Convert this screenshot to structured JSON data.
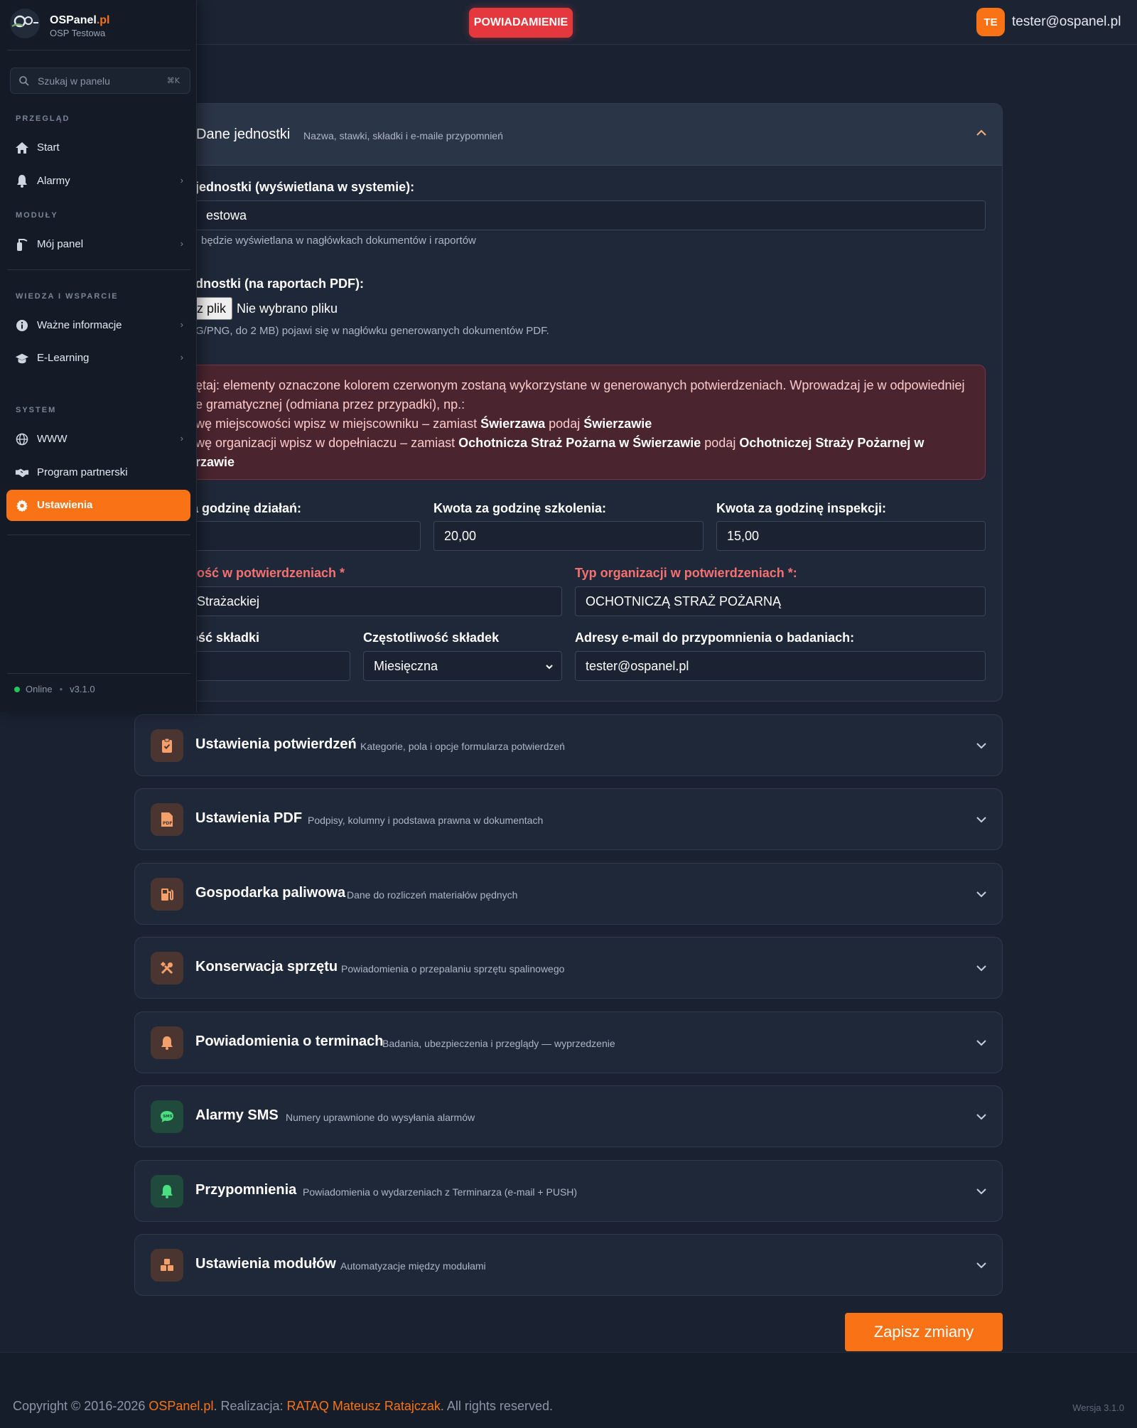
{
  "colors": {
    "accent": "#f97316",
    "alert": "#e5383e",
    "background": "#1a2232",
    "sidebar": "#141b27",
    "online": "#22c55e",
    "required_label": "#f87171"
  },
  "header": {
    "alert_button": "POWIADAMIENIE",
    "avatar_initials": "TE",
    "user_email": "tester@ospanel.pl"
  },
  "sidebar": {
    "brand_name": "OSPanel",
    "brand_tld": ".pl",
    "brand_sub": "OSP Testowa",
    "search_placeholder": "Szukaj w panelu",
    "search_shortcut": "⌘K",
    "sections": {
      "overview": "PRZEGLĄD",
      "modules": "MODUŁY",
      "knowledge": "WIEDZA I WSPARCIE",
      "system": "SYSTEM"
    },
    "items": [
      {
        "label": "Start",
        "icon": "home-icon"
      },
      {
        "label": "Alarmy",
        "icon": "bell-icon"
      },
      {
        "label": "Mój panel",
        "icon": "fire-extinguisher-icon"
      },
      {
        "label": "Ważne informacje",
        "icon": "info-icon"
      },
      {
        "label": "E-Learning",
        "icon": "graduation-cap-icon"
      },
      {
        "label": "WWW",
        "icon": "globe-icon"
      },
      {
        "label": "Program partnerski",
        "icon": "handshake-icon"
      },
      {
        "label": "Ustawienia",
        "icon": "gear-icon"
      }
    ],
    "status": "Online",
    "version": "v3.1.0"
  },
  "unit_panel": {
    "title": "Dane jednostki",
    "subtitle": "Nazwa, stawki, składki i e-maile przypomnień",
    "name_label": "jednostki (wyświetlana w systemie):",
    "name_value": "estowa",
    "name_help": "będzie wyświetlana w nagłówkach dokumentów i raportów",
    "logo_label": "dnostki (na raportach PDF):",
    "file_button": "z plik",
    "file_status": "Nie wybrano pliku",
    "logo_help": "G/PNG, do 2 MB) pojawi się w nagłówku generowanych dokumentów PDF.",
    "note": {
      "line1": "ętaj: elementy oznaczone kolorem czerwonym zostaną wykorzystane w generowanych potwierdzeniach. Wprowadzaj je w odpowiedniej",
      "line2": "e gramatycznej (odmiana przez przypadki), np.:",
      "line3_a": "wę miejscowości wpisz w miejscowniku – zamiast ",
      "line3_b": "Świerzawa",
      "line3_c": " podaj ",
      "line3_d": "Świerzawie",
      "line4_a": "wę organizacji wpisz w dopełniaczu – zamiast ",
      "line4_b": "Ochotnicza Straż Pożarna w Świerzawie",
      "line4_c": " podaj ",
      "line4_d": "Ochotniczej Straży Pożarnej w",
      "line5": "rzawie"
    },
    "rate_action_label": "za godzinę działań:",
    "rate_action_value": "",
    "rate_training_label": "Kwota za godzinę szkolenia:",
    "rate_training_value": "20,00",
    "rate_inspection_label": "Kwota za godzinę inspekcji:",
    "rate_inspection_value": "15,00",
    "locality_label": "wość w potwierdzeniach *",
    "locality_value": "Strażackiej",
    "org_type_label": "Typ organizacji w potwierdzeniach *:",
    "org_type_value": "OCHOTNICZĄ STRAŻ POŻARNĄ",
    "fee_label": "ość składki",
    "fee_value": "",
    "freq_label": "Częstotliwość składek",
    "freq_value": "Miesięczna",
    "emails_label": "Adresy e-mail do przypomnienia o badaniach:",
    "emails_value": "tester@ospanel.pl"
  },
  "panels": [
    {
      "title": "Ustawienia potwierdzeń",
      "subtitle": "Kategorie, pola i opcje formularza potwierdzeń",
      "icon": "clipboard-check-icon"
    },
    {
      "title": "Ustawienia PDF",
      "subtitle": "Podpisy, kolumny i podstawa prawna w dokumentach",
      "icon": "pdf-file-icon"
    },
    {
      "title": "Gospodarka paliwowa",
      "subtitle": "Dane do rozliczeń materiałów pędnych",
      "icon": "gas-pump-icon"
    },
    {
      "title": "Konserwacja sprzętu",
      "subtitle": "Powiadomienia o przepalaniu sprzętu spalinowego",
      "icon": "tools-icon"
    },
    {
      "title": "Powiadomienia o terminach",
      "subtitle": "Badania, ubezpieczenia i przeglądy — wyprzedzenie",
      "icon": "bell-icon"
    },
    {
      "title": "Alarmy SMS",
      "subtitle": "Numery uprawnione do wysyłania alarmów",
      "icon": "sms-icon"
    },
    {
      "title": "Przypomnienia",
      "subtitle": "Powiadomienia o wydarzeniach z Terminarza (e-mail + PUSH)",
      "icon": "bell-icon"
    },
    {
      "title": "Ustawienia modułów",
      "subtitle": "Automatyzacje między modułami",
      "icon": "cubes-icon"
    }
  ],
  "save_button": "Zapisz zmiany",
  "footer": {
    "copy_prefix": "Copyright © 2016-2026 ",
    "copy_brand": "OSPanel.pl",
    "copy_mid": ". Realizacja: ",
    "copy_author": "RATAQ Mateusz Ratajczak",
    "copy_suffix": ". All rights reserved.",
    "version": "Wersja 3.1.0"
  }
}
